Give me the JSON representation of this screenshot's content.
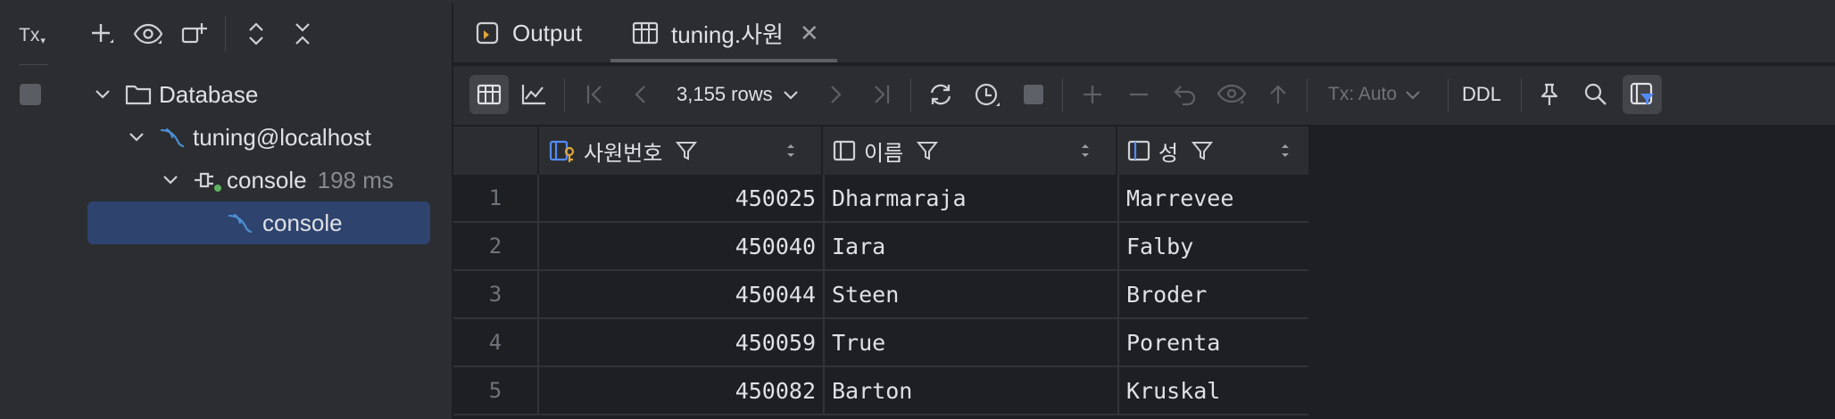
{
  "left_panel": {
    "tx_label": "Tx",
    "tree": [
      {
        "label": "Database",
        "icon": "folder-icon"
      },
      {
        "label": "tuning@localhost",
        "icon": "mysql-icon"
      },
      {
        "label": "console",
        "meta": "198 ms",
        "icon": "console-session-icon"
      },
      {
        "label": "console",
        "icon": "mysql-icon",
        "selected": true
      }
    ]
  },
  "tabs": [
    {
      "label": "Output",
      "icon": "output-icon"
    },
    {
      "label": "tuning.사원",
      "icon": "table-icon",
      "active": true
    }
  ],
  "toolbar": {
    "rows_label": "3,155 rows",
    "tx_mode": "Tx: Auto",
    "ddl_label": "DDL"
  },
  "table": {
    "columns": [
      "사원번호",
      "이름",
      "성"
    ],
    "rows": [
      {
        "n": "1",
        "cells": [
          "450025",
          "Dharmaraja",
          "Marrevee"
        ]
      },
      {
        "n": "2",
        "cells": [
          "450040",
          "Iara",
          "Falby"
        ]
      },
      {
        "n": "3",
        "cells": [
          "450044",
          "Steen",
          "Broder"
        ]
      },
      {
        "n": "4",
        "cells": [
          "450059",
          "True",
          "Porenta"
        ]
      },
      {
        "n": "5",
        "cells": [
          "450082",
          "Barton",
          "Kruskal"
        ]
      }
    ]
  },
  "colors": {
    "accent": "#548af7",
    "selection": "#2e436e",
    "mysql": "#4d8fd1"
  }
}
